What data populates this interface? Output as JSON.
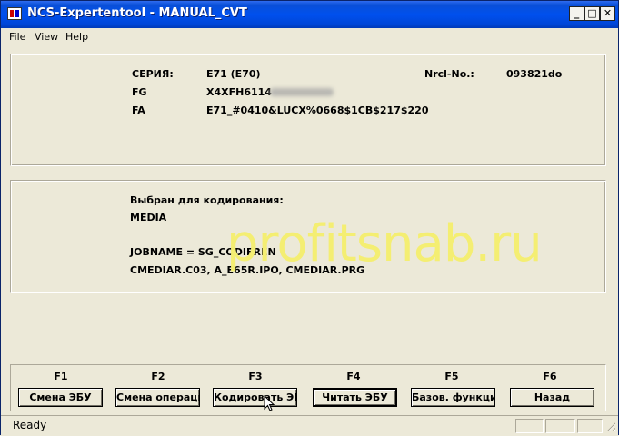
{
  "window": {
    "title": "NCS-Expertentool - MANUAL_CVT",
    "controls": {
      "minimize": "_",
      "maximize": "□",
      "close": "✕"
    }
  },
  "menu": {
    "items": [
      "File",
      "View",
      "Help"
    ]
  },
  "vehicle": {
    "series_label": "СЕРИЯ:",
    "series_value": "E71 (E70)",
    "nrcl_label": "Nrcl-No.:",
    "nrcl_value": "093821do",
    "fg_label": "FG",
    "fg_value": "X4XFH6114",
    "fa_label": "FA",
    "fa_value": "E71_#0410&LUCX%0668$1CB$217$220"
  },
  "coding": {
    "selected_label": "Выбран для кодирования:",
    "module": "MEDIA",
    "jobname": "JOBNAME = SG_CODIEREN",
    "files": "CMEDIAR.C03, A_E65R.IPO, CMEDIAR.PRG"
  },
  "watermark": "profitsnab.ru",
  "function_keys": [
    {
      "key": "F1",
      "label": "Смена ЭБУ"
    },
    {
      "key": "F2",
      "label": "Смена операции"
    },
    {
      "key": "F3",
      "label": "Кодировать ЭБУ"
    },
    {
      "key": "F4",
      "label": "Читать ЭБУ"
    },
    {
      "key": "F5",
      "label": "Базов. функции"
    },
    {
      "key": "F6",
      "label": "Назад"
    }
  ],
  "status": {
    "text": "Ready"
  }
}
